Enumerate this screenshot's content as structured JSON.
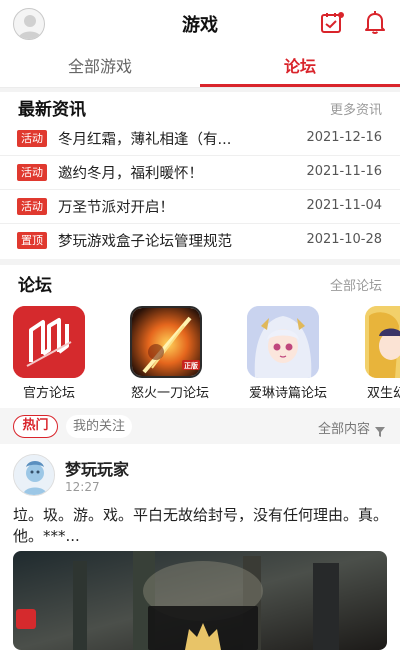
{
  "header": {
    "title": "游戏",
    "icons": [
      "user-avatar-icon",
      "checkin-calendar-icon",
      "notification-bell-icon"
    ]
  },
  "tabs": [
    {
      "label": "全部游戏",
      "active": false
    },
    {
      "label": "论坛",
      "active": true
    }
  ],
  "news": {
    "title": "最新资讯",
    "more": "更多资讯",
    "items": [
      {
        "tag": "活动",
        "title": "冬月红霜，薄礼相逢（有...",
        "date": "2021-12-16"
      },
      {
        "tag": "活动",
        "title": "邀约冬月，福利暖怀！",
        "date": "2021-11-16"
      },
      {
        "tag": "活动",
        "title": "万圣节派对开启！",
        "date": "2021-11-04"
      },
      {
        "tag": "置顶",
        "title": "梦玩游戏盒子论坛管理规范",
        "date": "2021-10-28"
      }
    ]
  },
  "forums": {
    "title": "论坛",
    "more": "全部论坛",
    "items": [
      {
        "name": "官方论坛",
        "icon": "official-forum-logo-icon"
      },
      {
        "name": "怒火一刀论坛",
        "icon": "nuhuo-yidao-game-icon",
        "badge": "正版"
      },
      {
        "name": "爱琳诗篇论坛",
        "icon": "ailin-shipian-game-icon"
      },
      {
        "name": "双生幻",
        "icon": "shuangsheng-game-icon"
      }
    ]
  },
  "filter": {
    "hot": "热门",
    "following": "我的关注",
    "all_content": "全部内容"
  },
  "post": {
    "user": "梦玩玩家",
    "time": "12:27",
    "text_line1": "垃。圾。游。戏。平白无故给封号，没有任何理由。真。",
    "text_line2": "他。***..."
  },
  "colors": {
    "accent": "#d9242b",
    "tag_bg": "#e0392f",
    "muted": "#9a9a9a",
    "divider": "#f3f3f3"
  }
}
